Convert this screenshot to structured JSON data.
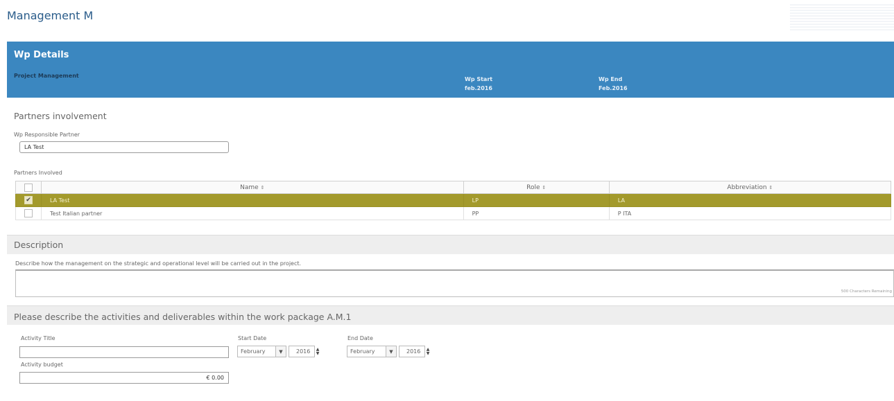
{
  "page": {
    "title": "Management M"
  },
  "wp_header": {
    "title": "Wp Details",
    "subtitle": "Project Management",
    "start_label": "Wp Start",
    "start_value": "feb.2016",
    "end_label": "Wp End",
    "end_value": "Feb.2016"
  },
  "partners": {
    "section_title": "Partners involvement",
    "responsible_label": "Wp Responsible Partner",
    "responsible_value": "LA Test",
    "involved_label": "Partners Involved",
    "columns": [
      "Name",
      "Role",
      "Abbreviation"
    ],
    "sort_icon": "sort-icon",
    "rows": [
      {
        "selected": true,
        "name": "LA Test",
        "role": "LP",
        "abbreviation": "LA"
      },
      {
        "selected": false,
        "name": "Test Italian partner",
        "role": "PP",
        "abbreviation": "P ITA"
      }
    ]
  },
  "description": {
    "section_title": "Description",
    "prompt": "Describe how the management on the strategic and operational level will be carried out in the project.",
    "value": "",
    "remaining": "500 Characters Remaining"
  },
  "activities": {
    "section_title": "Please describe the activities and deliverables within the work package A.M.1",
    "activity_title_label": "Activity Title",
    "activity_title_value": "",
    "start_date_label": "Start Date",
    "start_month": "February",
    "start_year": "2016",
    "end_date_label": "End Date",
    "end_month": "February",
    "end_year": "2016",
    "budget_label": "Activity budget",
    "budget_value": "€ 0.00"
  },
  "colors": {
    "header_bg": "#3b87c0",
    "title_blue": "#2a5c8a",
    "selected_row": "#a39a2c"
  }
}
